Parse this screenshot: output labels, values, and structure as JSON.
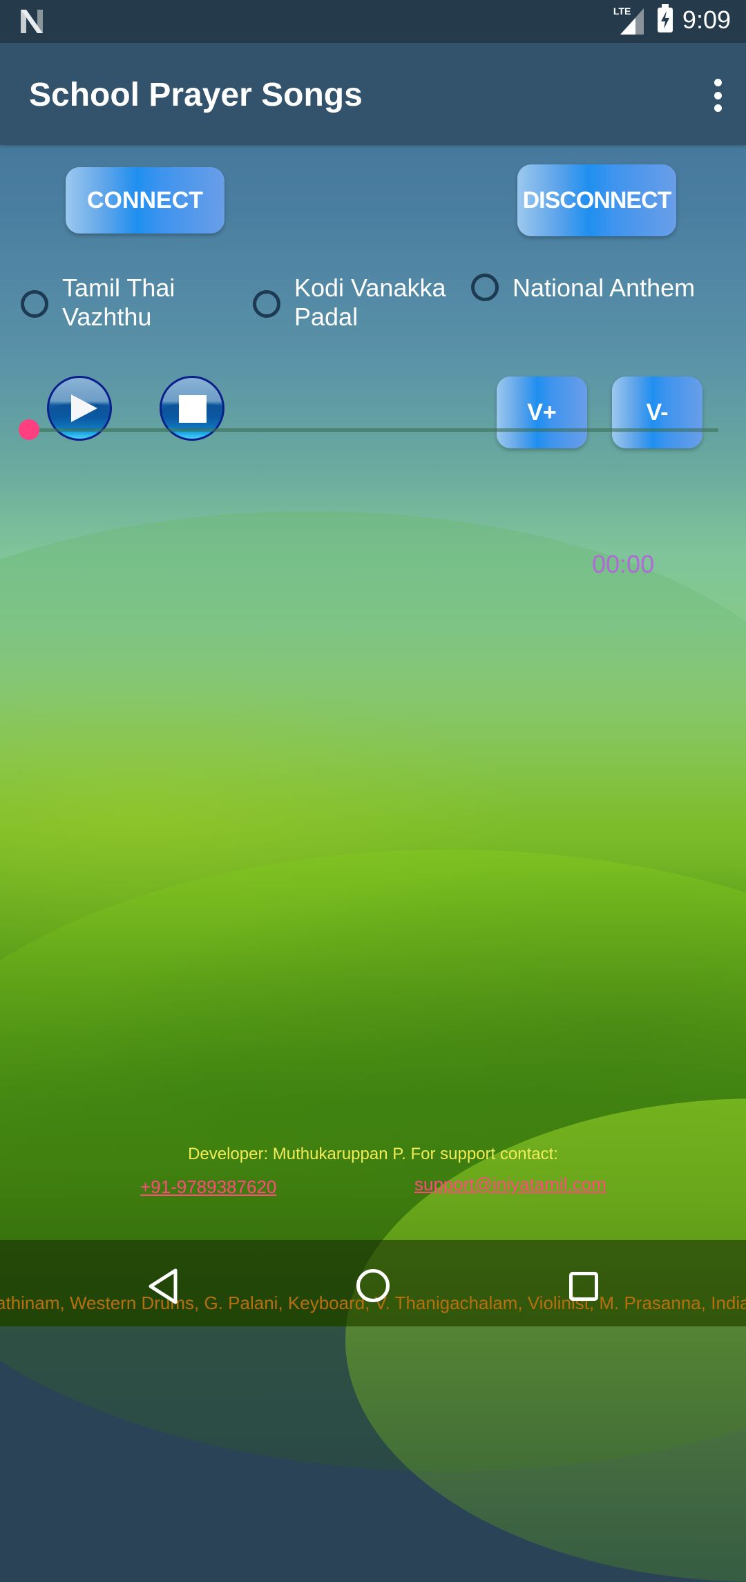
{
  "status_bar": {
    "notification_icon": "n-logo-icon",
    "network_label": "LTE",
    "signal_icon": "signal-icon",
    "battery_icon": "battery-charging-icon",
    "time": "9:09"
  },
  "app_bar": {
    "title": "School Prayer Songs",
    "overflow_icon": "more-vert-icon"
  },
  "controls": {
    "connect_label": "CONNECT",
    "disconnect_label": "DISCONNECT",
    "volume_up_label": "V+",
    "volume_down_label": "V-"
  },
  "songs": [
    {
      "label_line1": "Tamil Thai",
      "label_line2": "Vazhthu",
      "selected": false
    },
    {
      "label_line1": "Kodi Vanakka",
      "label_line2": "Padal",
      "selected": false
    },
    {
      "label_line1": "National Anthem",
      "label_line2": "",
      "selected": false
    }
  ],
  "player": {
    "play_icon": "play-icon",
    "stop_icon": "stop-icon",
    "progress": 0,
    "elapsed": "00:00"
  },
  "footer": {
    "developer_text": "Developer: Muthukaruppan P. For support contact:",
    "phone": "+91-9789387620",
    "email": "support@iniyatamil.com"
  },
  "marquee": {
    "text": "athinam, Western Drums, G. Palani, Keyboard, V. Thanigachalam, Violinist, M. Prasanna, Indian"
  },
  "nav_bar": {
    "back_icon": "back-icon",
    "home_icon": "home-icon",
    "recents_icon": "recents-icon"
  },
  "colors": {
    "accent": "#ff3f7f",
    "app_bar": "#33536c",
    "status_bar": "#253a4b",
    "button_blue": "#1f8ff0",
    "time_text": "#b06ad6",
    "developer_text": "#f0ec58",
    "link_text": "#ff4a7a",
    "marquee_text": "#b7700d"
  }
}
